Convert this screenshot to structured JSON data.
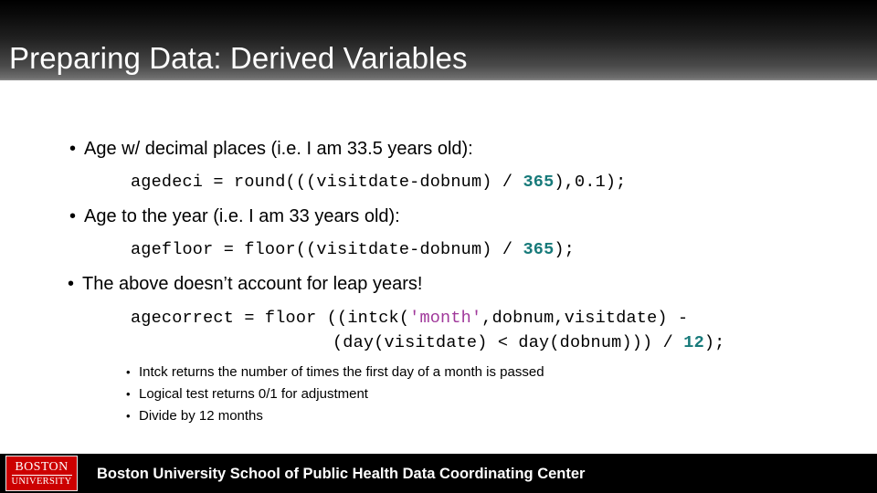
{
  "slide": {
    "title": "Preparing Data: Derived Variables"
  },
  "content": {
    "bullet1": {
      "marker": "•",
      "text": "Age w/ decimal places (i.e. I am 33.5 years old):"
    },
    "code1": {
      "part1": "agedeci = round(((visitdate-dobnum) / ",
      "number": "365",
      "part2": "),0.1);"
    },
    "bullet2": {
      "marker": "•",
      "text": "Age to the year (i.e. I am 33 years old):"
    },
    "code2": {
      "part1": "agefloor = floor((visitdate-dobnum) / ",
      "number": "365",
      "part2": ");"
    },
    "bullet3": {
      "marker": "•",
      "text": "The above doesn’t account for leap years!"
    },
    "code3": {
      "line1_part1": "agecorrect = floor ((intck(",
      "line1_string": "'month'",
      "line1_part2": ",dobnum,visitdate) -",
      "line2_part1": "(day(visitdate) < day(dobnum))) / ",
      "line2_number": "12",
      "line2_part2": ");"
    },
    "subbullets": [
      {
        "marker": "•",
        "text": "Intck returns the number of times the first day of a month is passed"
      },
      {
        "marker": "•",
        "text": "Logical test returns 0/1 for adjustment"
      },
      {
        "marker": "•",
        "text": "Divide by 12 months"
      }
    ]
  },
  "footer": {
    "logo_top": "BOSTON",
    "logo_bottom": "UNIVERSITY",
    "text": "Boston University School of Public Health Data Coordinating Center"
  },
  "colors": {
    "header_dark": "#000000",
    "header_light": "#8a8a8a",
    "code_number": "#177a7a",
    "code_string": "#a0399b",
    "logo_red": "#cc0000",
    "footer_bg": "#000000"
  }
}
